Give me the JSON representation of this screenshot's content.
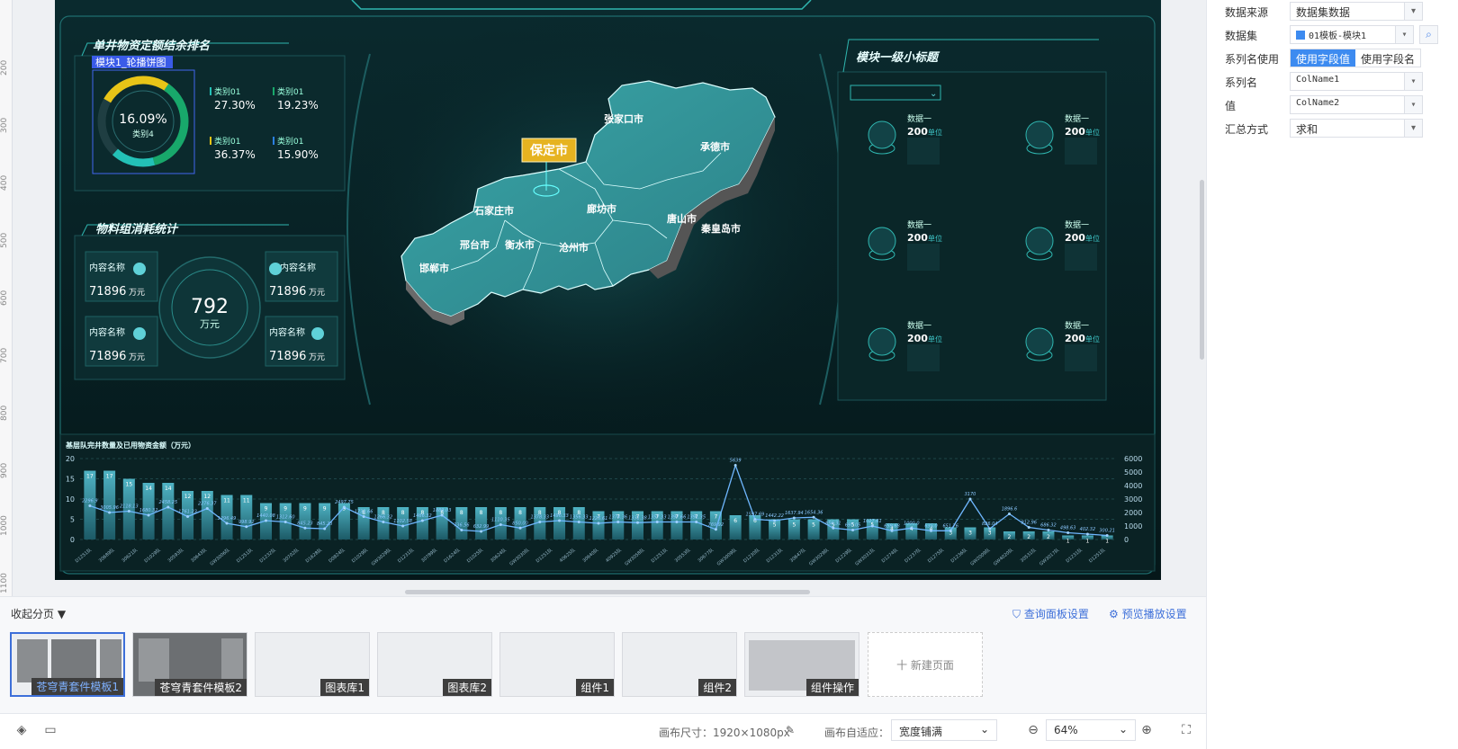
{
  "ruler": {
    "ticks": [
      "200",
      "300",
      "400",
      "500",
      "600",
      "700",
      "800",
      "900",
      "1000",
      "1100"
    ]
  },
  "dashboard": {
    "panel1_title": "单井物资定额结余排名",
    "selection_label": "模块1_轮播饼图",
    "ring_value": "16.09%",
    "ring_caption": "类别4",
    "legend": [
      {
        "name": "类别01",
        "value": "27.30%"
      },
      {
        "name": "类别01",
        "value": "19.23%"
      },
      {
        "name": "类别01",
        "value": "36.37%"
      },
      {
        "name": "类别01",
        "value": "15.90%"
      }
    ],
    "panel2_title": "物料组消耗统计",
    "cards": [
      {
        "label": "内容名称",
        "value": "71896",
        "unit": "万元"
      },
      {
        "label": "内容名称",
        "value": "71896",
        "unit": "万元"
      },
      {
        "label": "内容名称",
        "value": "71896",
        "unit": "万元"
      },
      {
        "label": "内容名称",
        "value": "71896",
        "unit": "万元"
      }
    ],
    "center_value": "792",
    "center_unit": "万元",
    "map_cities": [
      "张家口市",
      "承德市",
      "保定市",
      "廊坊市",
      "石家庄市",
      "唐山市",
      "秦皇岛市",
      "邢台市",
      "衡水市",
      "沧州市",
      "邯郸市"
    ],
    "map_highlight": "保定市",
    "panel3_title": "模块一级小标题",
    "stats": [
      {
        "label": "数据一",
        "value": "200",
        "unit": "单位"
      },
      {
        "label": "数据一",
        "value": "200",
        "unit": "单位"
      },
      {
        "label": "数据一",
        "value": "200",
        "unit": "单位"
      },
      {
        "label": "数据一",
        "value": "200",
        "unit": "单位"
      },
      {
        "label": "数据一",
        "value": "200",
        "unit": "单位"
      },
      {
        "label": "数据一",
        "value": "200",
        "unit": "单位"
      }
    ]
  },
  "chart_data": {
    "type": "bar",
    "title": "基层队完井数量及已用物资金额（万元）",
    "left_ylim": [
      0,
      20
    ],
    "left_ticks": [
      "0",
      "5",
      "10",
      "15",
      "20"
    ],
    "right_ylim": [
      0,
      6000
    ],
    "right_ticks": [
      "0",
      "1000",
      "2000",
      "3000",
      "4000",
      "5000",
      "6000"
    ],
    "categories": [
      "D1251队",
      "30689队",
      "30621队",
      "D1029队",
      "30593队",
      "30643队",
      "GW3006队",
      "D1251队",
      "D1232队",
      "30702队",
      "D1628队",
      "D0824队",
      "D1029队",
      "GW3029队",
      "D1231队",
      "30789队",
      "D1624队",
      "D1025队",
      "30624队",
      "GW3030队",
      "D1251队",
      "40625队",
      "30640队",
      "40925队",
      "GW3058队",
      "D1251队",
      "30553队",
      "30677队",
      "GW3009队",
      "D1230队",
      "D1231队",
      "30647队",
      "GW3029队",
      "D1229队",
      "GW3031队",
      "D1274队",
      "D1237队",
      "D1275队",
      "D1236队",
      "GW2009队",
      "GW4020队",
      "30531队",
      "GW3017队",
      "D1231队",
      "D1251队"
    ],
    "series": [
      {
        "name": "",
        "axis": "left",
        "values": [
          17,
          17,
          15,
          14,
          14,
          12,
          12,
          11,
          11,
          9,
          9,
          9,
          9,
          9,
          8,
          8,
          8,
          8,
          8,
          8,
          8,
          8,
          8,
          8,
          8,
          8,
          7,
          7,
          7,
          7,
          7,
          7,
          7,
          6,
          6,
          5,
          5,
          5,
          5,
          5,
          5,
          4,
          4,
          4,
          3,
          3,
          3,
          2,
          2,
          2,
          1,
          1,
          1
        ]
      },
      {
        "name": "",
        "axis": "right",
        "values": [
          2500,
          2000,
          2100,
          1800,
          2400,
          1700,
          2300,
          1200,
          950,
          1400,
          1300,
          850,
          800,
          2400,
          1700,
          1300,
          1000,
          1400,
          1800,
          700,
          600,
          1100,
          850,
          1300,
          1400,
          1300,
          1200,
          1300,
          1250,
          1300,
          1300,
          1300,
          750,
          5500,
          1500,
          1400,
          1600,
          1650,
          850,
          700,
          1000,
          650,
          850,
          650,
          650,
          3000,
          800,
          1900,
          900,
          700,
          500,
          400,
          300
        ]
      },
      {
        "name": "",
        "axis": "labels",
        "values": [
          "2296.9",
          "3005.96",
          "2118.13",
          "1680.32",
          "2458.25",
          "1761.23",
          "2276.37",
          "1296.49",
          "998.92",
          "1440.08",
          "1312.60",
          "845.23",
          "845.23",
          "2497.75",
          "1732.66",
          "1266.32",
          "1102.58",
          "1466.32",
          "1889.03",
          "736.56",
          "632.99",
          "1110.35",
          "850.00",
          "1378.33",
          "1496.33",
          "1356.33",
          "1225.61",
          "1374.36",
          "1331.38",
          "1357.33",
          "1397.66",
          "1391.35",
          "769.92",
          "5639",
          "1597.69",
          "1442.22",
          "1637.94",
          "1654.36",
          "856.31",
          "697.05",
          "1027.61",
          "659.68",
          "1000.0",
          "635.0",
          "651.76",
          "3170",
          "826.04",
          "1896.6",
          "912.96",
          "686.32",
          "498.63",
          "402.32",
          "300.21"
        ]
      }
    ]
  },
  "props": {
    "rows": [
      {
        "label": "数据来源",
        "value": "数据集数据"
      },
      {
        "label": "数据集",
        "value": "01模板-模块1"
      },
      {
        "label": "系列名使用",
        "seg_on": "使用字段值",
        "seg_off": "使用字段名"
      },
      {
        "label": "系列名",
        "value": "ColName1"
      },
      {
        "label": "值",
        "value": "ColName2"
      },
      {
        "label": "汇总方式",
        "value": "求和"
      }
    ]
  },
  "pages": {
    "collapse_label": "收起分页",
    "query_settings": "查询面板设置",
    "preview_settings": "预览播放设置",
    "thumbs": [
      "苍穹青套件模板1",
      "苍穹青套件模板2",
      "图表库1",
      "图表库2",
      "组件1",
      "组件2",
      "组件操作"
    ],
    "new_page": "十 新建页面"
  },
  "bottombar": {
    "canvas_size_label": "画布尺寸：1920×1080px",
    "fit_label": "画布自适应：",
    "fit_value": "宽度铺满",
    "zoom": "64%"
  }
}
